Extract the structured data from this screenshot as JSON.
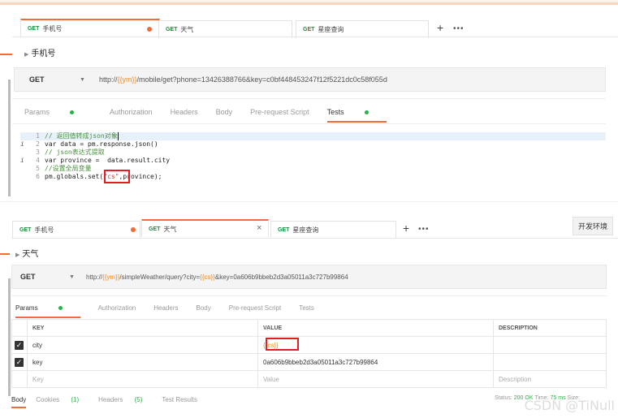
{
  "panel1": {
    "tabs": [
      {
        "method": "GET",
        "label": "手机号",
        "modified": true
      },
      {
        "method": "GET",
        "label": "天气"
      },
      {
        "method": "GET",
        "label": "星座查询"
      }
    ],
    "plus": "+",
    "more": "•••",
    "request_name": "手机号",
    "method": "GET",
    "url_prefix": "http://",
    "url_var": "{{ym}}",
    "url_rest": "/mobile/get?phone=13426388766&key=c0bf448453247f12f5221dc0c58f055d",
    "subtabs": [
      "Params",
      "Authorization",
      "Headers",
      "Body",
      "Pre-request Script",
      "Tests"
    ],
    "code": [
      {
        "n": "1",
        "info": "",
        "text": "// 返回值转成json对象"
      },
      {
        "n": "2",
        "info": "i",
        "text": "var data = pm.response.json()"
      },
      {
        "n": "3",
        "info": "",
        "text": "// json表达式提取"
      },
      {
        "n": "4",
        "info": "i",
        "text": "var province =  data.result.city"
      },
      {
        "n": "5",
        "info": "",
        "text": "//设置全局变量"
      },
      {
        "n": "6",
        "info": "",
        "pre": "pm.globals.set(",
        "str": "\"cs\"",
        "post": ",province);"
      }
    ]
  },
  "panel2": {
    "tabs": [
      {
        "method": "GET",
        "label": "手机号",
        "modified": true
      },
      {
        "method": "GET",
        "label": "天气",
        "close": "×"
      },
      {
        "method": "GET",
        "label": "星座查询"
      }
    ],
    "plus": "+",
    "more": "•••",
    "env_button": "开发环境",
    "request_name": "天气",
    "method": "GET",
    "url_prefix": "http://",
    "url_var1": "{{ym}}",
    "url_mid": "/simpleWeather/query?city=",
    "url_var2": "{{cs}}",
    "url_rest": "&key=0a606b9bbeb2d3a05011a3c727b99864",
    "subtabs": [
      "Params",
      "Authorization",
      "Headers",
      "Body",
      "Pre-request Script",
      "Tests"
    ],
    "table": {
      "headers": [
        "KEY",
        "VALUE",
        "DESCRIPTION"
      ],
      "rows": [
        {
          "checked": true,
          "key": "city",
          "value": "{{cs}}",
          "description": ""
        },
        {
          "checked": true,
          "key": "key",
          "value": "0a606b9bbeb2d3a05011a3c727b99864",
          "description": ""
        }
      ],
      "placeholder": {
        "key": "Key",
        "value": "Value",
        "description": "Description"
      }
    },
    "bottom_tabs": {
      "body": "Body",
      "cookies": "Cookies",
      "cookies_count": "(1)",
      "headers": "Headers",
      "headers_count": "(5)",
      "tests": "Test Results"
    },
    "status": {
      "label": "Status:",
      "code": "200 OK",
      "time_label": "Time:",
      "time": "75 ms",
      "size_label": "Size:"
    }
  },
  "watermark": "CSDN @TiNull"
}
